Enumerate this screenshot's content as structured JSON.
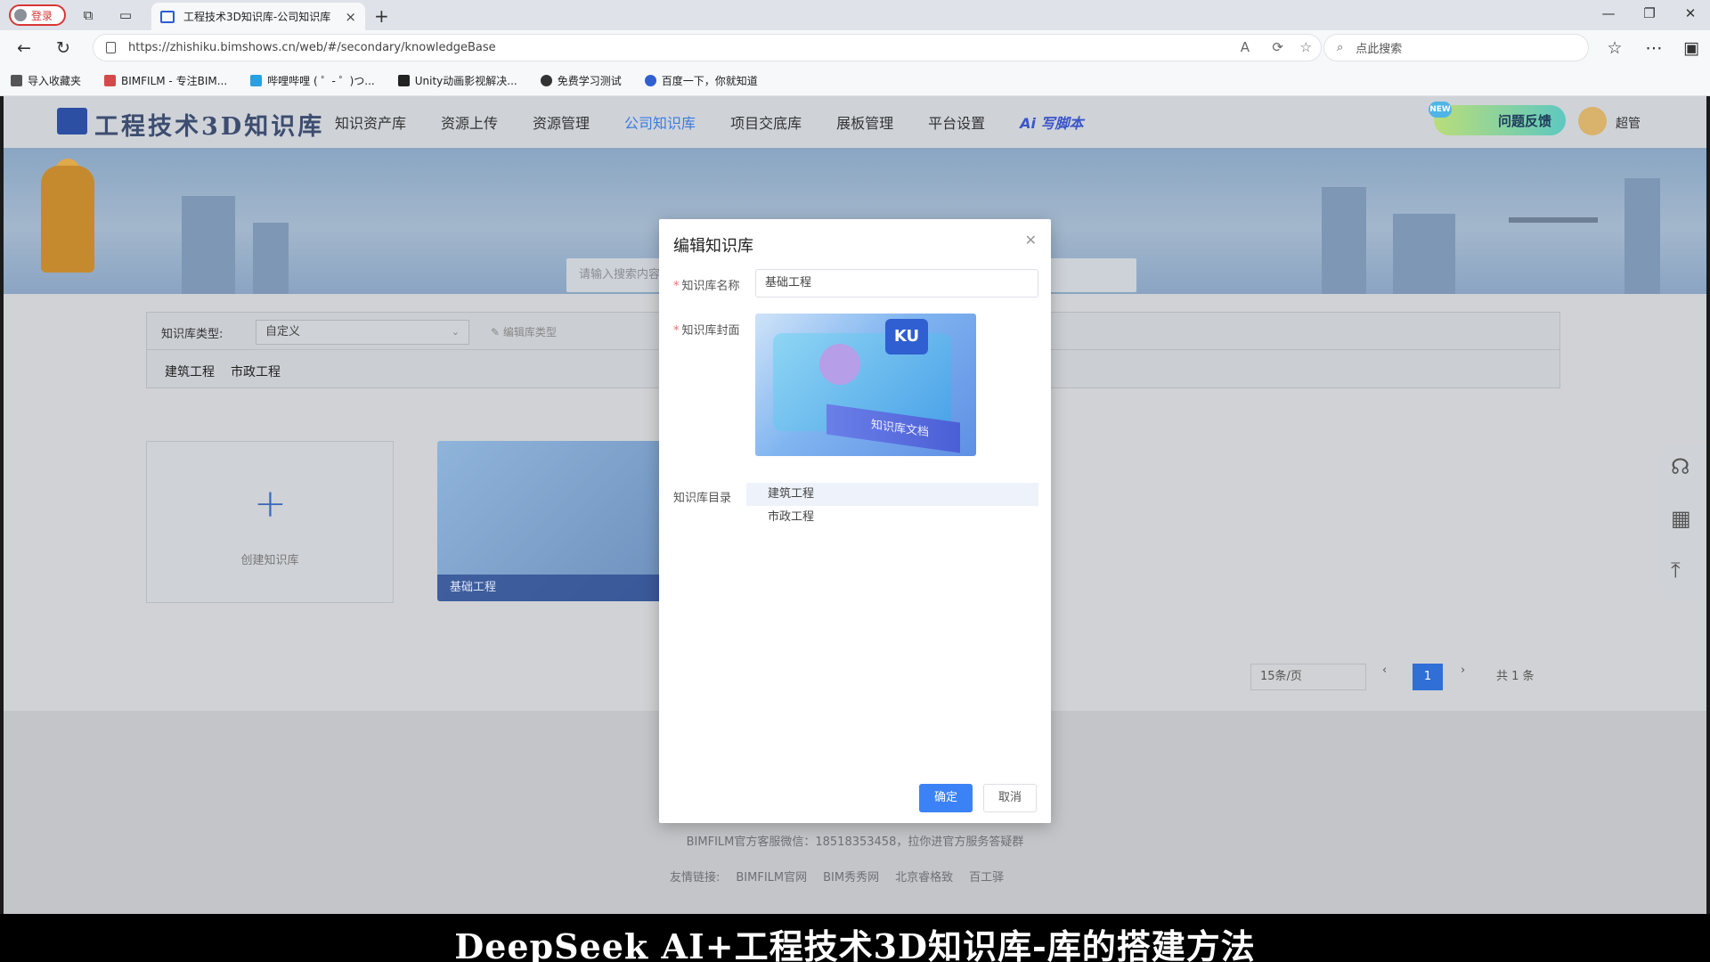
{
  "browser": {
    "login_label": "登录",
    "tab_title": "工程技术3D知识库-公司知识库",
    "url": "https://zhishiku.bimshows.cn/web/#/secondary/knowledgeBase",
    "search_placeholder": "点此搜索",
    "favorites": [
      {
        "label": "导入收藏夹",
        "color": "#555555"
      },
      {
        "label": "BIMFILM - 专注BIM...",
        "color": "#d44a4a"
      },
      {
        "label": "哔哩哔哩 ( ゜- ゜)つ...",
        "color": "#2aa0e0"
      },
      {
        "label": "Unity动画影视解决...",
        "color": "#222222"
      },
      {
        "label": "免费学习测试",
        "color": "#333333"
      },
      {
        "label": "百度一下，你就知道",
        "color": "#3060d0"
      }
    ]
  },
  "site": {
    "logo_text": "工程技术3D知识库",
    "menu": [
      "知识资产库",
      "资源上传",
      "资源管理",
      "公司知识库",
      "项目交底库",
      "展板管理",
      "平台设置"
    ],
    "active_menu": "公司知识库",
    "ai_label": "Ai 写脚本",
    "feedback_label": "问题反馈",
    "feedback_badge": "NEW",
    "user_name": "超管",
    "banner_search_placeholder": "请输入搜索内容"
  },
  "filter": {
    "type_label": "知识库类型:",
    "type_value": "自定义",
    "edit_type_label": "编辑库类型",
    "categories": [
      "建筑工程",
      "市政工程"
    ]
  },
  "cards": {
    "create_label": "创建知识库",
    "kb_title": "基础工程",
    "kb_cover_text": "知识库文档"
  },
  "pager": {
    "page_size": "15条/页",
    "current_page": "1",
    "total": "共 1 条"
  },
  "footer": {
    "service": "BIMFILM官方客服微信：18518353458，拉你进官方服务答疑群",
    "links_label": "友情链接:",
    "links": [
      "BIMFILM官网",
      "BIM秀秀网",
      "北京睿格致",
      "百工驿"
    ]
  },
  "modal": {
    "title": "编辑知识库",
    "name_label": "知识库名称",
    "name_value": "基础工程",
    "cover_label": "知识库封面",
    "cover_ku": "KU",
    "cover_text": "知识库文档",
    "dir_label": "知识库目录",
    "tree": [
      "建筑工程",
      "市政工程"
    ],
    "confirm": "确定",
    "cancel": "取消"
  },
  "caption": "DeepSeek AI+工程技术3D知识库-库的搭建方法",
  "colors": {
    "accent": "#3b82f6",
    "active_menu": "#3a7be0",
    "required": "#f56c6c"
  }
}
